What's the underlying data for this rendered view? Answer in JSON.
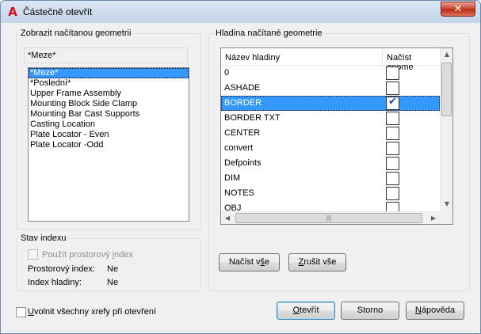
{
  "window": {
    "title": "Částečně otevřít",
    "close_glyph": "✕"
  },
  "left_group": {
    "label": "Zobrazit načítanou geometrii",
    "current_value": "*Meze*",
    "views": [
      {
        "label": "*Meze*",
        "selected": true
      },
      {
        "label": "*Poslední*",
        "selected": false
      },
      {
        "label": "Upper Frame Assembly",
        "selected": false
      },
      {
        "label": "Mounting Block Side Clamp",
        "selected": false
      },
      {
        "label": "Mounting Bar Cast Supports",
        "selected": false
      },
      {
        "label": "Casting Location",
        "selected": false
      },
      {
        "label": "Plate Locator - Even",
        "selected": false
      },
      {
        "label": "Plate Locator -Odd",
        "selected": false
      }
    ]
  },
  "index_group": {
    "label": "Stav indexu",
    "use_spatial_prefix": "Použít prostorový ",
    "use_spatial_mnemonic": "i",
    "use_spatial_suffix": "ndex",
    "spatial_index_label": "Prostorový index:",
    "spatial_index_value": "Ne",
    "layer_index_label": "Index hladiny:",
    "layer_index_value": "Ne"
  },
  "right_group": {
    "label": "Hladina načítané geometrie",
    "columns": [
      "Název hladiny",
      "Načíst geome"
    ],
    "layers": [
      {
        "name": "0",
        "load": false,
        "selected": false
      },
      {
        "name": "ASHADE",
        "load": false,
        "selected": false
      },
      {
        "name": "BORDER",
        "load": true,
        "selected": true
      },
      {
        "name": "BORDER TXT",
        "load": false,
        "selected": false
      },
      {
        "name": "CENTER",
        "load": false,
        "selected": false
      },
      {
        "name": "convert",
        "load": false,
        "selected": false
      },
      {
        "name": "Defpoints",
        "load": false,
        "selected": false
      },
      {
        "name": "DIM",
        "load": false,
        "selected": false
      },
      {
        "name": "NOTES",
        "load": false,
        "selected": false
      },
      {
        "name": "OBJ",
        "load": false,
        "selected": false
      }
    ],
    "tick_glyph": "✔",
    "load_all_prefix": "Načíst v",
    "load_all_mnemonic": "š",
    "load_all_suffix": "e",
    "clear_all_prefix": "",
    "clear_all_mnemonic": "Z",
    "clear_all_suffix": "rušit vše"
  },
  "footer": {
    "unload_xrefs_mnemonic": "U",
    "unload_xrefs_suffix": "volnit všechny xrefy při otevření",
    "open_prefix": "",
    "open_mnemonic": "O",
    "open_suffix": "tevřít",
    "cancel_label": "Storno",
    "help_prefix": "",
    "help_mnemonic": "N",
    "help_suffix": "ápověda"
  },
  "scroll": {
    "up": "▲",
    "down": "▼",
    "left": "◀",
    "right": "▶",
    "grip": "|||"
  }
}
